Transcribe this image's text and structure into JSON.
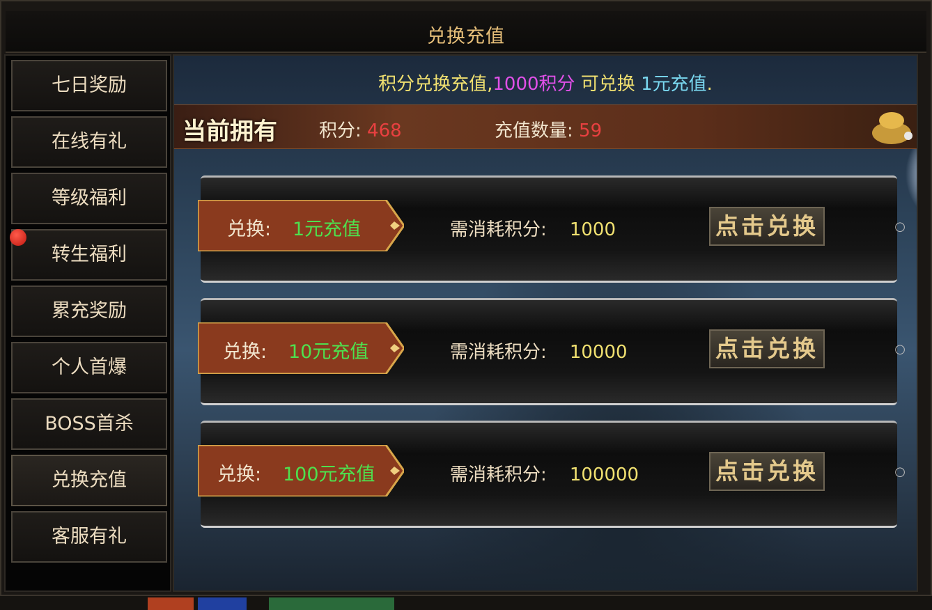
{
  "window": {
    "title": "兑换充值"
  },
  "sidebar": {
    "items": [
      {
        "label": "七日奖励"
      },
      {
        "label": "在线有礼"
      },
      {
        "label": "等级福利"
      },
      {
        "label": "转生福利"
      },
      {
        "label": "累充奖励"
      },
      {
        "label": "个人首爆"
      },
      {
        "label": "BOSS首杀"
      },
      {
        "label": "兑换充值"
      },
      {
        "label": "客服有礼"
      }
    ],
    "active": "兑换充值"
  },
  "info": {
    "prefix": "积分兑换充值,",
    "points": "1000积分",
    "mid": " 可兑换 ",
    "rmb": "1元充值",
    "suffix": "."
  },
  "owned": {
    "title": "当前拥有",
    "points_label": "积分: ",
    "points_value": "468",
    "recharge_label": "充值数量: ",
    "recharge_value": "59"
  },
  "exchanges": [
    {
      "label": "兑换:",
      "amount": "1元充值",
      "cost_label": "需消耗积分:",
      "cost": "1000",
      "button": "点击兑换"
    },
    {
      "label": "兑换:",
      "amount": "10元充值",
      "cost_label": "需消耗积分:",
      "cost": "10000",
      "button": "点击兑换"
    },
    {
      "label": "兑换:",
      "amount": "100元充值",
      "cost_label": "需消耗积分:",
      "cost": "100000",
      "button": "点击兑换"
    }
  ],
  "colors": {
    "accent_gold": "#e8c07a",
    "points_magenta": "#e050e8",
    "rmb_cyan": "#7ad8f0",
    "amount_green": "#4ee04e",
    "value_red": "#e84040"
  }
}
